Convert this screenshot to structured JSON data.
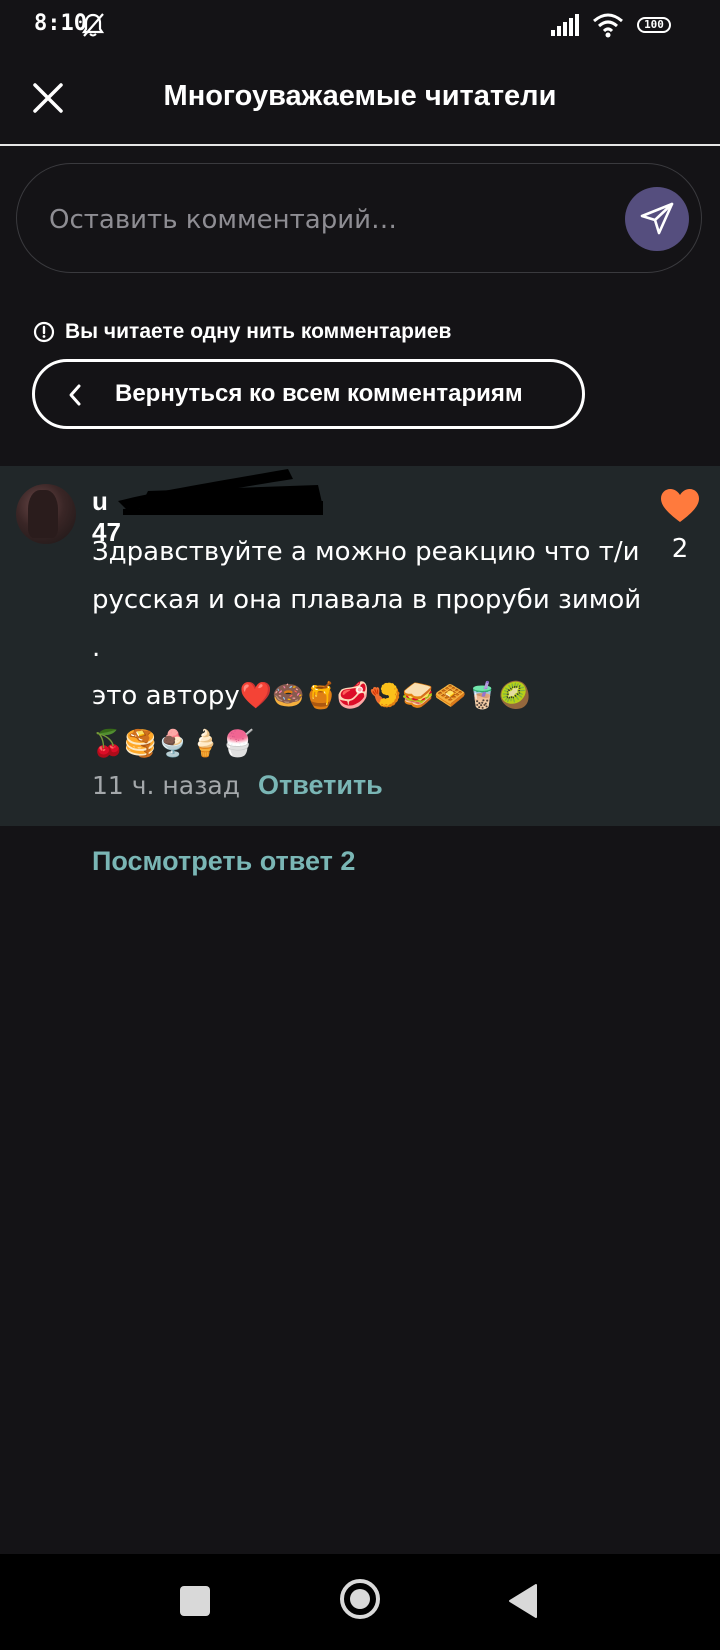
{
  "status_bar": {
    "time": "8:10",
    "battery": "100",
    "icons": [
      "bell-off-icon",
      "signal-icon",
      "wifi-icon",
      "battery-icon"
    ]
  },
  "header": {
    "title": "Многоуважаемые читатели",
    "close_icon": "close-icon"
  },
  "comment_input": {
    "placeholder": "Оставить комментарий…",
    "send_icon": "send-icon"
  },
  "thread_notice": {
    "text": "Вы читаете одну нить комментариев",
    "icon": "info-icon"
  },
  "back_button": {
    "label": "Вернуться ко всем комментариям",
    "icon": "chevron-left-icon"
  },
  "comment": {
    "username_prefix": "u",
    "username_suffix": "47",
    "text": "Здравствуйте а можно реакцию что т/и русская и она плавала в проруби зимой .\nэто автору❤️🍩🍯🥩🍤🥪🧇🧋🥝\n🍒🥞🍨🍦🍧",
    "time": "11 ч. назад",
    "reply_label": "Ответить",
    "like_count": "2",
    "like_color": "#ff7a3d"
  },
  "view_replies_label": "Посмотреть ответ 2",
  "colors": {
    "background": "#141316",
    "comment_bg": "#212729",
    "accent_teal": "#7ab6b5",
    "send_button": "#554e7e"
  },
  "nav_bar": {
    "icons": [
      "recents-square-icon",
      "home-circle-icon",
      "back-triangle-icon"
    ]
  }
}
